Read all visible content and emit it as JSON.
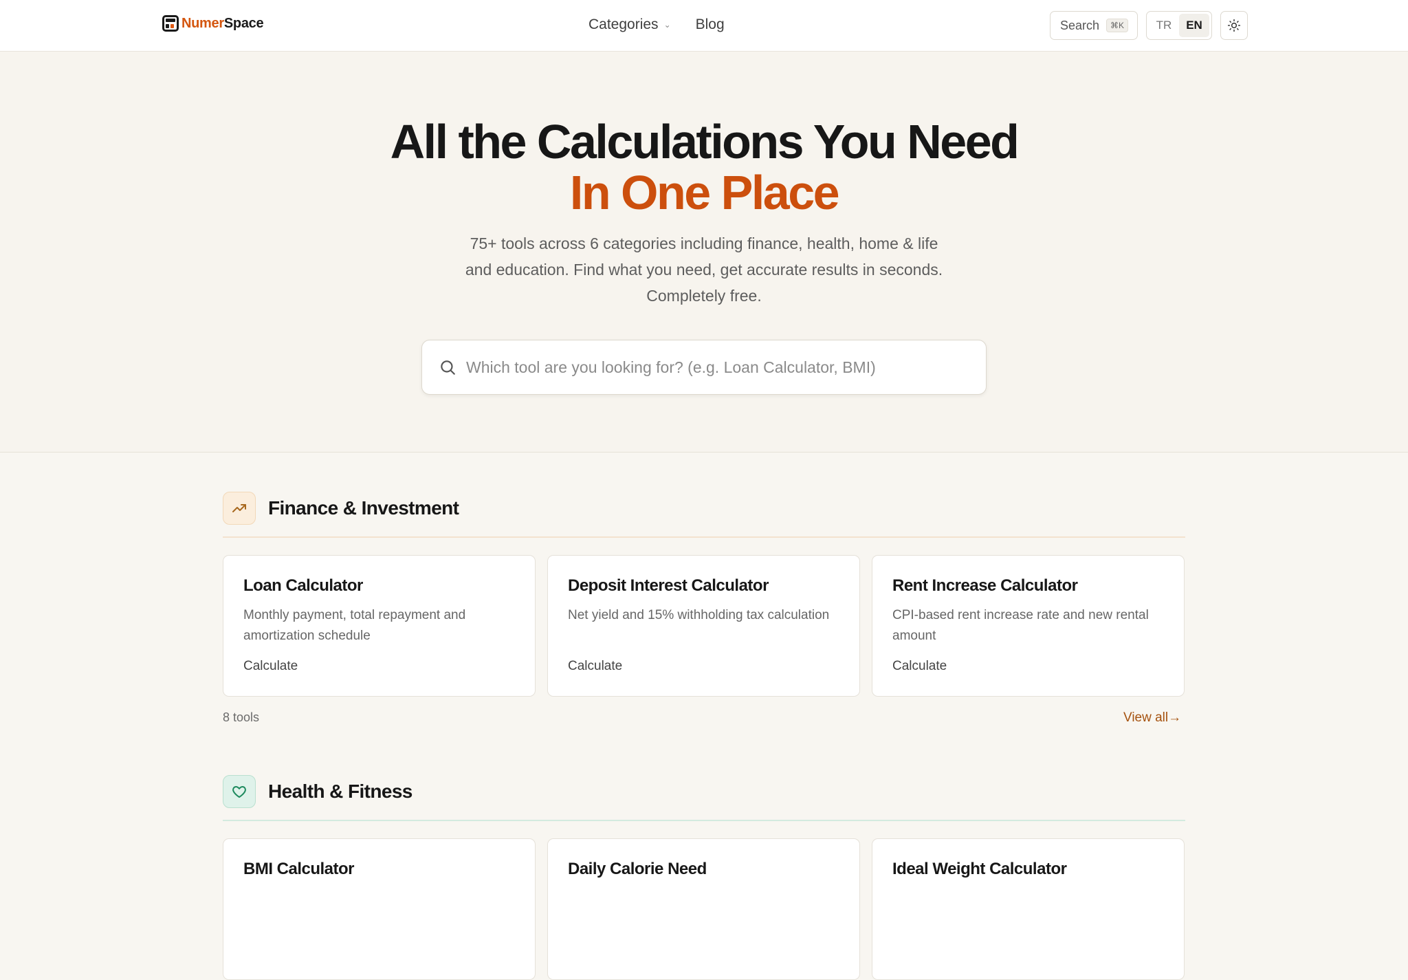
{
  "brand": {
    "part1": "Numer",
    "part2": "Space",
    "accent_color": "#d4560f"
  },
  "nav": {
    "categories_label": "Categories",
    "blog_label": "Blog",
    "search_label": "Search",
    "search_shortcut": "⌘K",
    "lang_tr": "TR",
    "lang_en": "EN",
    "active_lang": "EN"
  },
  "hero": {
    "title_line1": "All the Calculations You Need",
    "title_line2": "In One Place",
    "subtitle": "75+ tools across 6 categories including finance, health, home & life and education. Find what you need, get accurate results in seconds. Completely free.",
    "search_placeholder": "Which tool are you looking for? (e.g. Loan Calculator, BMI)"
  },
  "categories": [
    {
      "title": "Finance & Investment",
      "icon": "trending-up-icon",
      "tools": [
        {
          "title": "Loan Calculator",
          "desc": "Monthly payment, total repayment and amortization schedule",
          "cta": "Calculate"
        },
        {
          "title": "Deposit Interest Calculator",
          "desc": "Net yield and 15% withholding tax calculation",
          "cta": "Calculate"
        },
        {
          "title": "Rent Increase Calculator",
          "desc": "CPI-based rent increase rate and new rental amount",
          "cta": "Calculate"
        }
      ],
      "count": "8 tools",
      "view_all": "View all→"
    },
    {
      "title": "Health & Fitness",
      "icon": "heart-icon",
      "tools": [
        {
          "title": "BMI Calculator"
        },
        {
          "title": "Daily Calorie Need"
        },
        {
          "title": "Ideal Weight Calculator"
        }
      ]
    }
  ]
}
